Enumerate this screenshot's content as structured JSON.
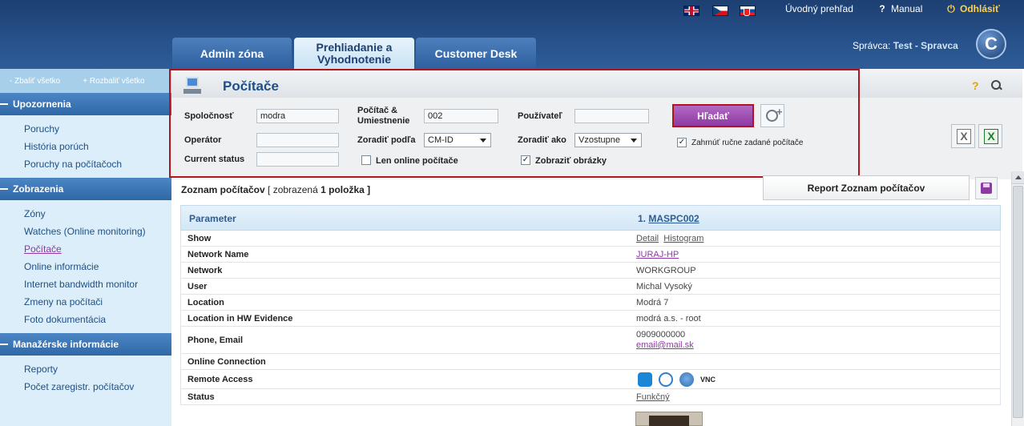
{
  "header": {
    "flags": [
      "uk-flag",
      "cz-flag",
      "sk-flag"
    ],
    "overview_label": "Úvodný prehľad",
    "manual_label": "Manual",
    "logout_label": "Odhlásiť",
    "tabs": [
      {
        "label": "Admin zóna"
      },
      {
        "label_line1": "Prehliadanie a",
        "label_line2": "Vyhodnotenie",
        "active": true
      },
      {
        "label": "Customer Desk"
      }
    ],
    "admin_prefix": "Správca:",
    "admin_name": "Test - Spravca",
    "logo_letter": "C"
  },
  "sidebar": {
    "collapse_all": "Zbaliť všetko",
    "expand_all": "Rozbaliť všetko",
    "sections": [
      {
        "title": "Upozornenia",
        "items": [
          "Poruchy",
          "História porúch",
          "Poruchy na počítačoch"
        ]
      },
      {
        "title": "Zobrazenia",
        "items": [
          "Zóny",
          "Watches (Online monitoring)",
          "Počítače",
          "Online informácie",
          "Internet bandwidth monitor",
          "Zmeny na počítači",
          "Foto dokumentácia"
        ],
        "active_item": "Počítače"
      },
      {
        "title": "Manažérske informácie",
        "items": [
          "Reporty",
          "Počet zaregistr. počítačov"
        ]
      }
    ]
  },
  "search": {
    "title": "Počítače",
    "company_label": "Spoločnosť",
    "company_value": "modra",
    "pc_label_line1": "Počítač &",
    "pc_label_line2": "Umiestnenie",
    "pc_value": "002",
    "user_label": "Používateľ",
    "user_value": "",
    "operator_label": "Operátor",
    "operator_value": "",
    "sort_by_label": "Zoradiť podľa",
    "sort_by_value": "CM-ID",
    "sort_how_label": "Zoradiť ako",
    "sort_how_value": "Vzostupne",
    "status_label": "Current status",
    "status_value": "",
    "online_only_label": "Len online počítače",
    "online_only_checked": false,
    "show_images_label": "Zobraziť obrázky",
    "show_images_checked": true,
    "include_manual_label": "Zahrnúť ručne zadané počítače",
    "include_manual_checked": true,
    "search_button": "Hľadať",
    "help_glyph": "?"
  },
  "list": {
    "title": "Zoznam počítačov",
    "shown_prefix": "[ zobrazená",
    "shown_count": "1",
    "shown_suffix": "položka ]",
    "report_button": "Report Zoznam počítačov",
    "col_param": "Parameter",
    "col_item_prefix": "1.",
    "col_item_name": "MASPC002",
    "rows": {
      "show": {
        "key": "Show",
        "detail": "Detail",
        "histogram": "Histogram"
      },
      "network_name": {
        "key": "Network Name",
        "value": "JURAJ-HP"
      },
      "network": {
        "key": "Network",
        "value": "WORKGROUP"
      },
      "user": {
        "key": "User",
        "value": "Michal Vysoký"
      },
      "location": {
        "key": "Location",
        "value": "Modrá 7"
      },
      "location_hw": {
        "key": "Location in HW Evidence",
        "value": "modrá a.s. - root"
      },
      "phone": {
        "key": "Phone, Email",
        "phone": "0909000000",
        "email": "email@mail.sk"
      },
      "online": {
        "key": "Online Connection",
        "value": ""
      },
      "remote": {
        "key": "Remote Access",
        "vnc": "VNC"
      },
      "status": {
        "key": "Status",
        "value": "Funkčný"
      }
    }
  }
}
